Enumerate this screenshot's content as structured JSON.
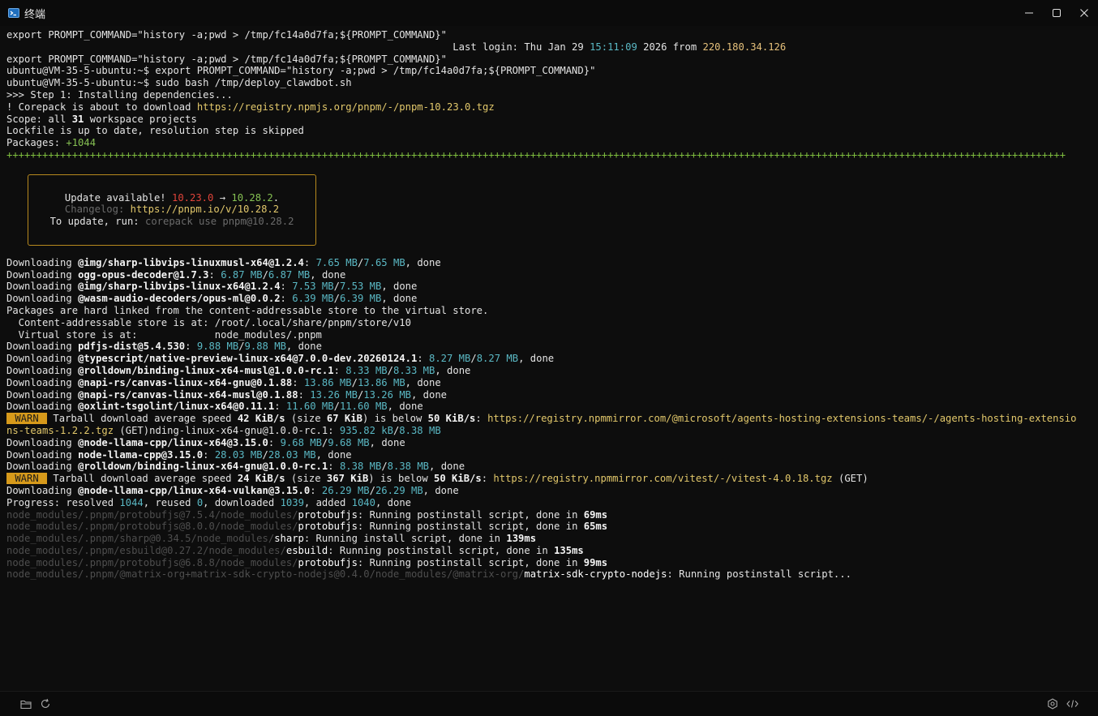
{
  "window": {
    "title": "终端"
  },
  "colors": {
    "warn_badge": "#d79a1b",
    "update_box_border": "#b7891e",
    "background": "#0d0d0d"
  },
  "icons": {
    "app": "terminal-icon",
    "minimize": "minimize-icon",
    "maximize": "maximize-icon",
    "close": "close-icon",
    "folder": "folder-icon",
    "refresh": "refresh-icon",
    "settings": "gear-icon",
    "code": "code-icon"
  },
  "terminal": {
    "lines": [
      [
        {
          "t": "export PROMPT_COMMAND=\"history -a;pwd > /tmp/fc14a0d7fa;${PROMPT_COMMAND}\"",
          "c": ""
        }
      ],
      [
        {
          "t": "                                                                           Last login: Thu Jan 29 ",
          "c": ""
        },
        {
          "t": "15:11:09",
          "c": "c-cyan"
        },
        {
          "t": " 2026 from ",
          "c": ""
        },
        {
          "t": "220.180.34.126",
          "c": "c-yellow"
        }
      ],
      [
        {
          "t": "export PROMPT_COMMAND=\"history -a;pwd > /tmp/fc14a0d7fa;${PROMPT_COMMAND}\"",
          "c": ""
        }
      ],
      [
        {
          "t": "ubuntu@VM-35-5-ubuntu:~$ export PROMPT_COMMAND=\"history -a;pwd > /tmp/fc14a0d7fa;${PROMPT_COMMAND}\"",
          "c": ""
        }
      ],
      [
        {
          "t": "ubuntu@VM-35-5-ubuntu:~$ sudo bash /tmp/deploy_clawdbot.sh",
          "c": ""
        }
      ],
      [
        {
          "t": ">>> Step 1: Installing dependencies...",
          "c": ""
        }
      ],
      [
        {
          "t": "! Corepack is about to download ",
          "c": ""
        },
        {
          "t": "https://registry.npmjs.org/pnpm/-/pnpm-10.23.0.tgz",
          "c": "c-url"
        }
      ],
      [
        {
          "t": "Scope: all ",
          "c": ""
        },
        {
          "t": "31",
          "c": "c-bold"
        },
        {
          "t": " workspace projects",
          "c": ""
        }
      ],
      [
        {
          "t": "Lockfile is up to date, resolution step is skipped",
          "c": ""
        }
      ],
      [
        {
          "t": "Packages: ",
          "c": ""
        },
        {
          "t": "+1044",
          "c": "c-green"
        }
      ],
      [
        {
          "t": "++++++++++++++++++++++++++++++++++++++++++++++++++++++++++++++++++++++++++++++++++++++++++++++++++++++++++++++++++++++++++++++++++++++++++++++++++++++++++++++++++++++++++++++++++",
          "c": "c-plus"
        }
      ]
    ],
    "update_box": {
      "lines": [
        [
          {
            "t": "Update available! ",
            "c": ""
          },
          {
            "t": "10.23.0",
            "c": "c-red"
          },
          {
            "t": " → ",
            "c": ""
          },
          {
            "t": "10.28.2",
            "c": "c-green"
          },
          {
            "t": ".",
            "c": ""
          }
        ],
        [
          {
            "t": "Changelog: ",
            "c": "c-gray"
          },
          {
            "t": "https://pnpm.io/v/10.28.2",
            "c": "c-url"
          }
        ],
        [
          {
            "t": "To update, run: ",
            "c": ""
          },
          {
            "t": "corepack use pnpm@10.28.2",
            "c": "c-gray"
          }
        ]
      ]
    },
    "lines2": [
      [
        {
          "t": "Downloading ",
          "c": ""
        },
        {
          "t": "@img/sharp-libvips-linuxmusl-x64@1.2.4",
          "c": "c-bold"
        },
        {
          "t": ": ",
          "c": ""
        },
        {
          "t": "7.65 MB",
          "c": "c-cyan"
        },
        {
          "t": "/",
          "c": ""
        },
        {
          "t": "7.65 MB",
          "c": "c-cyan"
        },
        {
          "t": ", done",
          "c": ""
        }
      ],
      [
        {
          "t": "Downloading ",
          "c": ""
        },
        {
          "t": "ogg-opus-decoder@1.7.3",
          "c": "c-bold"
        },
        {
          "t": ": ",
          "c": ""
        },
        {
          "t": "6.87 MB",
          "c": "c-cyan"
        },
        {
          "t": "/",
          "c": ""
        },
        {
          "t": "6.87 MB",
          "c": "c-cyan"
        },
        {
          "t": ", done",
          "c": ""
        }
      ],
      [
        {
          "t": "Downloading ",
          "c": ""
        },
        {
          "t": "@img/sharp-libvips-linux-x64@1.2.4",
          "c": "c-bold"
        },
        {
          "t": ": ",
          "c": ""
        },
        {
          "t": "7.53 MB",
          "c": "c-cyan"
        },
        {
          "t": "/",
          "c": ""
        },
        {
          "t": "7.53 MB",
          "c": "c-cyan"
        },
        {
          "t": ", done",
          "c": ""
        }
      ],
      [
        {
          "t": "Downloading ",
          "c": ""
        },
        {
          "t": "@wasm-audio-decoders/opus-ml@0.0.2",
          "c": "c-bold"
        },
        {
          "t": ": ",
          "c": ""
        },
        {
          "t": "6.39 MB",
          "c": "c-cyan"
        },
        {
          "t": "/",
          "c": ""
        },
        {
          "t": "6.39 MB",
          "c": "c-cyan"
        },
        {
          "t": ", done",
          "c": ""
        }
      ],
      [
        {
          "t": "Packages are hard linked from the content-addressable store to the virtual store.",
          "c": ""
        }
      ],
      [
        {
          "t": "  Content-addressable store is at: /root/.local/share/pnpm/store/v10",
          "c": ""
        }
      ],
      [
        {
          "t": "  Virtual store is at:             node_modules/.pnpm",
          "c": ""
        }
      ],
      [
        {
          "t": "Downloading ",
          "c": ""
        },
        {
          "t": "pdfjs-dist@5.4.530",
          "c": "c-bold"
        },
        {
          "t": ": ",
          "c": ""
        },
        {
          "t": "9.88 MB",
          "c": "c-cyan"
        },
        {
          "t": "/",
          "c": ""
        },
        {
          "t": "9.88 MB",
          "c": "c-cyan"
        },
        {
          "t": ", done",
          "c": ""
        }
      ],
      [
        {
          "t": "Downloading ",
          "c": ""
        },
        {
          "t": "@typescript/native-preview-linux-x64@7.0.0-dev.20260124.1",
          "c": "c-bold"
        },
        {
          "t": ": ",
          "c": ""
        },
        {
          "t": "8.27 MB",
          "c": "c-cyan"
        },
        {
          "t": "/",
          "c": ""
        },
        {
          "t": "8.27 MB",
          "c": "c-cyan"
        },
        {
          "t": ", done",
          "c": ""
        }
      ],
      [
        {
          "t": "Downloading ",
          "c": ""
        },
        {
          "t": "@rolldown/binding-linux-x64-musl@1.0.0-rc.1",
          "c": "c-bold"
        },
        {
          "t": ": ",
          "c": ""
        },
        {
          "t": "8.33 MB",
          "c": "c-cyan"
        },
        {
          "t": "/",
          "c": ""
        },
        {
          "t": "8.33 MB",
          "c": "c-cyan"
        },
        {
          "t": ", done",
          "c": ""
        }
      ],
      [
        {
          "t": "Downloading ",
          "c": ""
        },
        {
          "t": "@napi-rs/canvas-linux-x64-gnu@0.1.88",
          "c": "c-bold"
        },
        {
          "t": ": ",
          "c": ""
        },
        {
          "t": "13.86 MB",
          "c": "c-cyan"
        },
        {
          "t": "/",
          "c": ""
        },
        {
          "t": "13.86 MB",
          "c": "c-cyan"
        },
        {
          "t": ", done",
          "c": ""
        }
      ],
      [
        {
          "t": "Downloading ",
          "c": ""
        },
        {
          "t": "@napi-rs/canvas-linux-x64-musl@0.1.88",
          "c": "c-bold"
        },
        {
          "t": ": ",
          "c": ""
        },
        {
          "t": "13.26 MB",
          "c": "c-cyan"
        },
        {
          "t": "/",
          "c": ""
        },
        {
          "t": "13.26 MB",
          "c": "c-cyan"
        },
        {
          "t": ", done",
          "c": ""
        }
      ],
      [
        {
          "t": "Downloading ",
          "c": ""
        },
        {
          "t": "@oxlint-tsgolint/linux-x64@0.11.1",
          "c": "c-bold"
        },
        {
          "t": ": ",
          "c": ""
        },
        {
          "t": "11.60 MB",
          "c": "c-cyan"
        },
        {
          "t": "/",
          "c": ""
        },
        {
          "t": "11.60 MB",
          "c": "c-cyan"
        },
        {
          "t": ", done",
          "c": ""
        }
      ],
      [
        {
          "t": " WARN ",
          "c": "warn-badge"
        },
        {
          "t": " Tarball download average speed ",
          "c": ""
        },
        {
          "t": "42 KiB/s",
          "c": "c-bold"
        },
        {
          "t": " (size ",
          "c": ""
        },
        {
          "t": "67 KiB",
          "c": "c-bold"
        },
        {
          "t": ") is below ",
          "c": ""
        },
        {
          "t": "50 KiB/s",
          "c": "c-bold"
        },
        {
          "t": ": ",
          "c": ""
        },
        {
          "t": "https://registry.npmmirror.com/@microsoft/agents-hosting-extensions-teams/-/agents-hosting-extensio",
          "c": "c-url"
        }
      ],
      [
        {
          "t": "ns-teams-1.2.2.tgz",
          "c": "c-url"
        },
        {
          "t": " (GET)nding-linux-x64-gnu@1.0.0-rc.1: ",
          "c": ""
        },
        {
          "t": "935.82 kB",
          "c": "c-cyan"
        },
        {
          "t": "/",
          "c": ""
        },
        {
          "t": "8.38 MB",
          "c": "c-cyan"
        }
      ],
      [
        {
          "t": "Downloading ",
          "c": ""
        },
        {
          "t": "@node-llama-cpp/linux-x64@3.15.0",
          "c": "c-bold"
        },
        {
          "t": ": ",
          "c": ""
        },
        {
          "t": "9.68 MB",
          "c": "c-cyan"
        },
        {
          "t": "/",
          "c": ""
        },
        {
          "t": "9.68 MB",
          "c": "c-cyan"
        },
        {
          "t": ", done",
          "c": ""
        }
      ],
      [
        {
          "t": "Downloading ",
          "c": ""
        },
        {
          "t": "node-llama-cpp@3.15.0",
          "c": "c-bold"
        },
        {
          "t": ": ",
          "c": ""
        },
        {
          "t": "28.03 MB",
          "c": "c-cyan"
        },
        {
          "t": "/",
          "c": ""
        },
        {
          "t": "28.03 MB",
          "c": "c-cyan"
        },
        {
          "t": ", done",
          "c": ""
        }
      ],
      [
        {
          "t": "Downloading ",
          "c": ""
        },
        {
          "t": "@rolldown/binding-linux-x64-gnu@1.0.0-rc.1",
          "c": "c-bold"
        },
        {
          "t": ": ",
          "c": ""
        },
        {
          "t": "8.38 MB",
          "c": "c-cyan"
        },
        {
          "t": "/",
          "c": ""
        },
        {
          "t": "8.38 MB",
          "c": "c-cyan"
        },
        {
          "t": ", done",
          "c": ""
        }
      ],
      [
        {
          "t": " WARN ",
          "c": "warn-badge"
        },
        {
          "t": " Tarball download average speed ",
          "c": ""
        },
        {
          "t": "24 KiB/s",
          "c": "c-bold"
        },
        {
          "t": " (size ",
          "c": ""
        },
        {
          "t": "367 KiB",
          "c": "c-bold"
        },
        {
          "t": ") is below ",
          "c": ""
        },
        {
          "t": "50 KiB/s",
          "c": "c-bold"
        },
        {
          "t": ": ",
          "c": ""
        },
        {
          "t": "https://registry.npmmirror.com/vitest/-/vitest-4.0.18.tgz",
          "c": "c-url"
        },
        {
          "t": " (GET)",
          "c": ""
        }
      ],
      [
        {
          "t": "Downloading ",
          "c": ""
        },
        {
          "t": "@node-llama-cpp/linux-x64-vulkan@3.15.0",
          "c": "c-bold"
        },
        {
          "t": ": ",
          "c": ""
        },
        {
          "t": "26.29 MB",
          "c": "c-cyan"
        },
        {
          "t": "/",
          "c": ""
        },
        {
          "t": "26.29 MB",
          "c": "c-cyan"
        },
        {
          "t": ", done",
          "c": ""
        }
      ],
      [
        {
          "t": "Progress: resolved ",
          "c": ""
        },
        {
          "t": "1044",
          "c": "c-cyan"
        },
        {
          "t": ", reused ",
          "c": ""
        },
        {
          "t": "0",
          "c": "c-cyan"
        },
        {
          "t": ", downloaded ",
          "c": ""
        },
        {
          "t": "1039",
          "c": "c-cyan"
        },
        {
          "t": ", added ",
          "c": ""
        },
        {
          "t": "1040",
          "c": "c-cyan"
        },
        {
          "t": ", done",
          "c": ""
        }
      ],
      [
        {
          "t": "node_modules/.pnpm/protobufjs@7.5.4/node_modules/",
          "c": "c-dim"
        },
        {
          "t": "protobufjs",
          "c": "c-white"
        },
        {
          "t": ": Running postinstall script, done in ",
          "c": ""
        },
        {
          "t": "69ms",
          "c": "c-bold"
        }
      ],
      [
        {
          "t": "node_modules/.pnpm/protobufjs@8.0.0/node_modules/",
          "c": "c-dim"
        },
        {
          "t": "protobufjs",
          "c": "c-white"
        },
        {
          "t": ": Running postinstall script, done in ",
          "c": ""
        },
        {
          "t": "65ms",
          "c": "c-bold"
        }
      ],
      [
        {
          "t": "node_modules/.pnpm/sharp@0.34.5/node_modules/",
          "c": "c-dim"
        },
        {
          "t": "sharp",
          "c": "c-white"
        },
        {
          "t": ": Running install script, done in ",
          "c": ""
        },
        {
          "t": "139ms",
          "c": "c-bold"
        }
      ],
      [
        {
          "t": "node_modules/.pnpm/esbuild@0.27.2/node_modules/",
          "c": "c-dim"
        },
        {
          "t": "esbuild",
          "c": "c-white"
        },
        {
          "t": ": Running postinstall script, done in ",
          "c": ""
        },
        {
          "t": "135ms",
          "c": "c-bold"
        }
      ],
      [
        {
          "t": "node_modules/.pnpm/protobufjs@6.8.8/node_modules/",
          "c": "c-dim"
        },
        {
          "t": "protobufjs",
          "c": "c-white"
        },
        {
          "t": ": Running postinstall script, done in ",
          "c": ""
        },
        {
          "t": "99ms",
          "c": "c-bold"
        }
      ],
      [
        {
          "t": "node_modules/.pnpm/@matrix-org+matrix-sdk-crypto-nodejs@0.4.0/node_modules/@matrix-org/",
          "c": "c-dim"
        },
        {
          "t": "matrix-sdk-crypto-nodejs",
          "c": "c-white"
        },
        {
          "t": ": Running postinstall script...",
          "c": ""
        }
      ]
    ]
  }
}
